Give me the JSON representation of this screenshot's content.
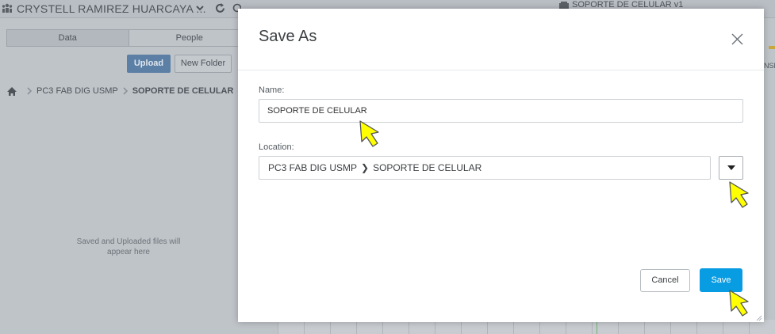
{
  "app": {
    "team_name": "CRYSTELL RAMIREZ HUARCAYA ...",
    "document_title": "SOPORTE DE CELULAR  v1",
    "tabs": [
      {
        "label": "Data",
        "active": true
      },
      {
        "label": "People",
        "active": false
      }
    ],
    "upload_label": "Upload",
    "new_folder_label": "New Folder",
    "breadcrumb": {
      "parent": "PC3 FAB DIG USMP",
      "current": "SOPORTE DE CELULAR"
    },
    "empty_message_line1": "Saved and Uploaded files will",
    "empty_message_line2": "appear here",
    "edge_text": "NSF"
  },
  "dialog": {
    "title": "Save As",
    "name_label": "Name:",
    "name_value": "SOPORTE DE CELULAR",
    "location_label": "Location:",
    "location_parent": "PC3 FAB DIG USMP",
    "location_separator": "❯",
    "location_current": "SOPORTE DE CELULAR",
    "cancel_label": "Cancel",
    "save_label": "Save"
  },
  "colors": {
    "save_button": "#089ce2",
    "upload_button": "#5b7fa5",
    "pointer_fill": "#ffff00"
  }
}
